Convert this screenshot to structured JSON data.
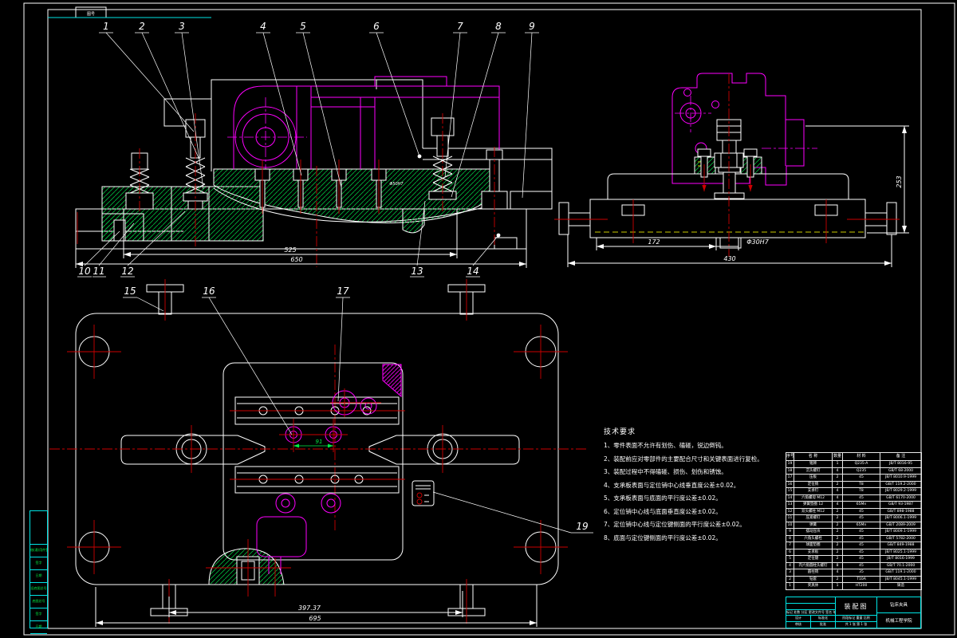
{
  "drawing": {
    "doc_type": "assembly-drawing",
    "colors": {
      "background": "#000000",
      "line": "#ffffff",
      "frame": "#00e5e5",
      "part": "#ff00ff",
      "centerline": "#cc0000",
      "hatch": "#00b33c",
      "aux": "#cccc00"
    },
    "frame": {
      "top_label": "图号"
    },
    "front_view": {
      "callouts_top": [
        "1",
        "2",
        "3",
        "4",
        "5",
        "6",
        "7",
        "8",
        "9"
      ],
      "callouts_bottom": [
        "10",
        "11",
        "12",
        "13",
        "14"
      ],
      "dims": {
        "inner": "525",
        "outer": "650",
        "bore": "Φ50H7"
      }
    },
    "side_view": {
      "dims": {
        "left": "172",
        "fit": "Φ30H7",
        "total": "430",
        "height": "253"
      }
    },
    "plan_view": {
      "callouts": [
        "15",
        "16",
        "17",
        "19"
      ],
      "dims": {
        "pin_span": "91",
        "post_span": "397.37",
        "total": "695"
      }
    },
    "tech_notes": {
      "title": "技术要求",
      "items": [
        "1、零件表面不允许有划伤、磕碰，锐边倒钝。",
        "2、装配前应对零部件的主要配合尺寸和关键表面进行复检。",
        "3、装配过程中不得磕碰、损伤、划伤和锈蚀。",
        "4、支承板表面与定位销中心线垂直度公差±0.02。",
        "5、支承板表面与底面的平行度公差±0.02。",
        "6、定位销中心线与底面垂直度公差±0.02。",
        "7、定位销中心线与定位键侧面的平行度公差±0.02。",
        "8、底面与定位键侧面的平行度公差±0.02。"
      ]
    },
    "bom": {
      "headers": [
        "序号",
        "名  称",
        "数量",
        "材 料",
        "备  注"
      ],
      "rows": [
        {
          "no": "19",
          "name": "铭牌",
          "qty": "1",
          "mat": "Q235-A",
          "note": "JB/T 8016-95"
        },
        {
          "no": "18",
          "name": "沉头螺钉",
          "qty": "4",
          "mat": "Q235",
          "note": "GB/T 68-2000"
        },
        {
          "no": "17",
          "name": "压板",
          "qty": "2",
          "mat": "45",
          "note": "JB/T 8010.9-1999"
        },
        {
          "no": "16",
          "name": "定位销",
          "qty": "2",
          "mat": "T8",
          "note": "GB/T 119.2-2000"
        },
        {
          "no": "15",
          "name": "支承钉",
          "qty": "4",
          "mat": "T8",
          "note": "JB/T 8029.2-1999"
        },
        {
          "no": "14",
          "name": "六角螺母 M12",
          "qty": "4",
          "mat": "45",
          "note": "GB/T 6170-2000"
        },
        {
          "no": "13",
          "name": "弹簧垫圈 12",
          "qty": "4",
          "mat": "65Mn",
          "note": "GB/T 93-1987"
        },
        {
          "no": "12",
          "name": "双头螺柱 M12",
          "qty": "2",
          "mat": "45",
          "note": "GB/T 898-1988"
        },
        {
          "no": "11",
          "name": "压紧螺钉",
          "qty": "2",
          "mat": "45",
          "note": "JB/T 8006.1-1999"
        },
        {
          "no": "10",
          "name": "弹簧",
          "qty": "2",
          "mat": "65Mn",
          "note": "GB/T 2089-2009"
        },
        {
          "no": "9",
          "name": "摆动压块",
          "qty": "2",
          "mat": "45",
          "note": "JB/T 8009.1-1999"
        },
        {
          "no": "8",
          "name": "六角头螺栓",
          "qty": "2",
          "mat": "45",
          "note": "GB/T 5782-2000"
        },
        {
          "no": "7",
          "name": "球面垫圈",
          "qty": "2",
          "mat": "45",
          "note": "GB/T 849-1988"
        },
        {
          "no": "6",
          "name": "支承板",
          "qty": "2",
          "mat": "45",
          "note": "JB/T 8025.1-1999"
        },
        {
          "no": "5",
          "name": "定位键",
          "qty": "2",
          "mat": "45",
          "note": "JB/T 8016-1999"
        },
        {
          "no": "4",
          "name": "内六角圆柱头螺钉",
          "qty": "8",
          "mat": "45",
          "note": "GB/T 70.1-2000"
        },
        {
          "no": "3",
          "name": "圆柱销",
          "qty": "4",
          "mat": "35",
          "note": "GB/T 119.1-2000"
        },
        {
          "no": "2",
          "name": "钻套",
          "qty": "2",
          "mat": "T10A",
          "note": "JB/T 8045.1-1999"
        },
        {
          "no": "1",
          "name": "夹具体",
          "qty": "1",
          "mat": "HT200",
          "note": "铸造"
        }
      ]
    },
    "title_block": {
      "mark_row": "标记 处数 分区 更改文件号 签名 年月日",
      "row_design": "设计",
      "row_std": "标准化",
      "row_check": "审核",
      "row_appr": "批准",
      "name": "装配图",
      "stage_cells": "阶段标记  重量  比例",
      "sheet": "共 1 张  第 1 张",
      "code": "钻床夹具",
      "org": "机械工程学院"
    },
    "side_strip": {
      "cells": [
        "借(通)用件登记",
        "签字",
        "日期",
        "旧底图总号",
        "底图总号",
        "签字",
        "日期"
      ]
    }
  }
}
